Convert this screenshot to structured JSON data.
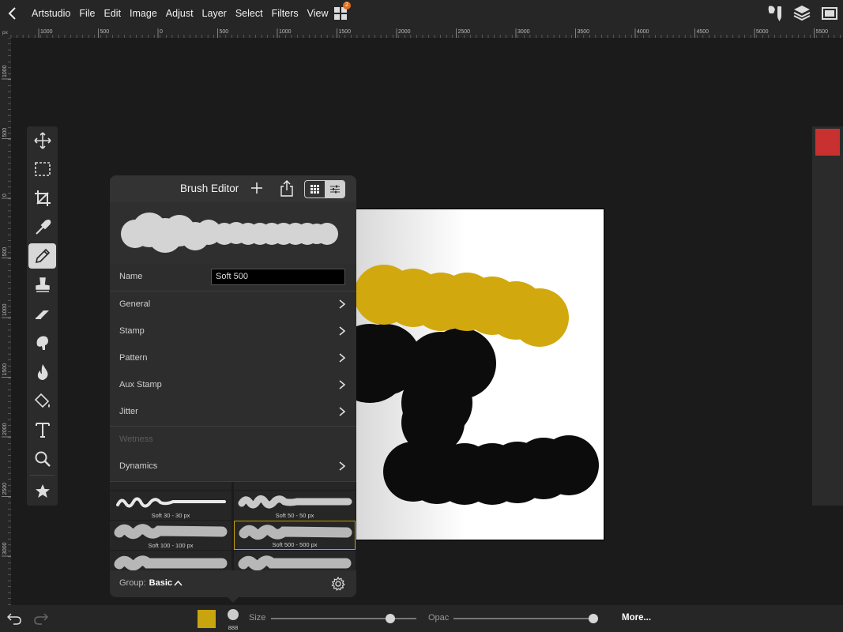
{
  "app": {
    "title": "Artstudio"
  },
  "menu": [
    "File",
    "Edit",
    "Image",
    "Adjust",
    "Layer",
    "Select",
    "Filters",
    "View"
  ],
  "badge_count": "2",
  "ruler": {
    "unit": "px",
    "h_labels": [
      "1000",
      "500",
      "0",
      "500",
      "1000",
      "1500",
      "2000",
      "2500",
      "3000",
      "3500",
      "4000",
      "4500",
      "5000",
      "5500"
    ],
    "v_labels": [
      "1000",
      "500",
      "0",
      "500",
      "1000",
      "1500",
      "2000",
      "2500",
      "3000"
    ]
  },
  "tools": [
    "move-icon",
    "marquee-icon",
    "crop-icon",
    "eyedropper-icon",
    "pencil-icon",
    "stamp-icon",
    "eraser-icon",
    "smudge-icon",
    "burn-icon",
    "fill-icon",
    "text-icon",
    "zoom-icon",
    "star-icon"
  ],
  "active_tool": "pencil-icon",
  "brush_editor": {
    "title": "Brush Editor",
    "name_label": "Name",
    "name_value": "Soft 500",
    "rows": [
      {
        "label": "General",
        "enabled": true
      },
      {
        "label": "Stamp",
        "enabled": true
      },
      {
        "label": "Pattern",
        "enabled": true
      },
      {
        "label": "Aux Stamp",
        "enabled": true
      },
      {
        "label": "Jitter",
        "enabled": true
      },
      {
        "label": "Wetness",
        "enabled": false
      },
      {
        "label": "Dynamics",
        "enabled": true
      }
    ],
    "presets": [
      {
        "caption": "Soft 30 - 30 px",
        "selected": false
      },
      {
        "caption": "Soft 50 - 50 px",
        "selected": false
      },
      {
        "caption": "Soft 100 - 100 px",
        "selected": false
      },
      {
        "caption": "Soft 500 - 500 px",
        "selected": true
      }
    ],
    "group_label": "Group:",
    "group_value": "Basic"
  },
  "bottom": {
    "brush_size_value": "888",
    "size_label": "Size",
    "size_fraction": 0.82,
    "opacity_label": "Opac",
    "opacity_fraction": 1.0,
    "more_label": "More..."
  },
  "colors": {
    "primary": "#c8a40f",
    "secondary": "#c93131"
  }
}
